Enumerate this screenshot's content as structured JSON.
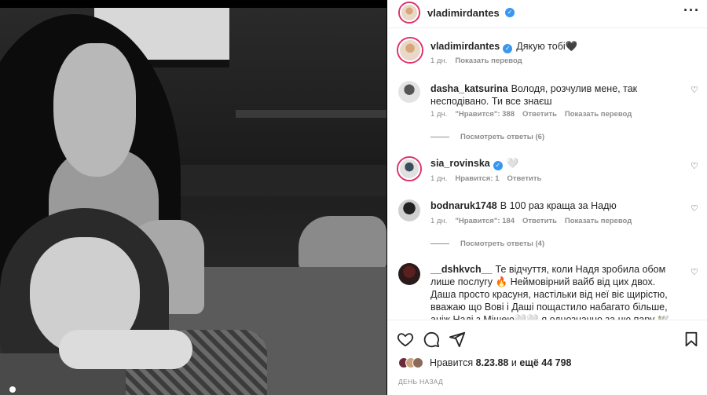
{
  "post": {
    "author": "vladimirdantes",
    "more_icon": "more-options-icon"
  },
  "caption": {
    "username": "vladimirdantes",
    "text": "Дякую тобі🖤",
    "time": "1 дн.",
    "translate": "Показать перевод"
  },
  "comments": [
    {
      "username": "dasha_katsurina",
      "text": "Володя, розчулив мене, так несподівано. Ти все знаєш",
      "time": "1 дн.",
      "likes": "\"Нравится\": 388",
      "reply": "Ответить",
      "translate": "Показать перевод",
      "replies": "Посмотреть ответы (6)"
    },
    {
      "username": "sia_rovinska",
      "text": "🤍",
      "time": "1 дн.",
      "likes": "Нравится: 1",
      "reply": "Ответить"
    },
    {
      "username": "bodnaruk1748",
      "text": "В 100 раз краща за Надю",
      "time": "1 дн.",
      "likes": "\"Нравится\": 184",
      "reply": "Ответить",
      "translate": "Показать перевод",
      "replies": "Посмотреть ответы (4)"
    },
    {
      "username": "__dshkvch__",
      "text": "Те відчуття, коли Надя зробила обом лише послугу 🔥 Неймовірний вайб від цих двох. Даша просто красуня, настільки від неї віє щирістю, вважаю що Вові і Даші пощастило набагато більше, аніж Наді з Мішею🤍🤍 я однозначно за цю пару 🕊️"
    }
  ],
  "likes": {
    "prefix": "Нравится",
    "user": "8.23.88",
    "middle": "и",
    "rest": "ещё 44 798"
  },
  "timestamp": "ДЕНЬ НАЗАД",
  "colors": {
    "verified": "#3897f0",
    "story_ring": "#e1306c",
    "meta_text": "#8e8e8e"
  }
}
